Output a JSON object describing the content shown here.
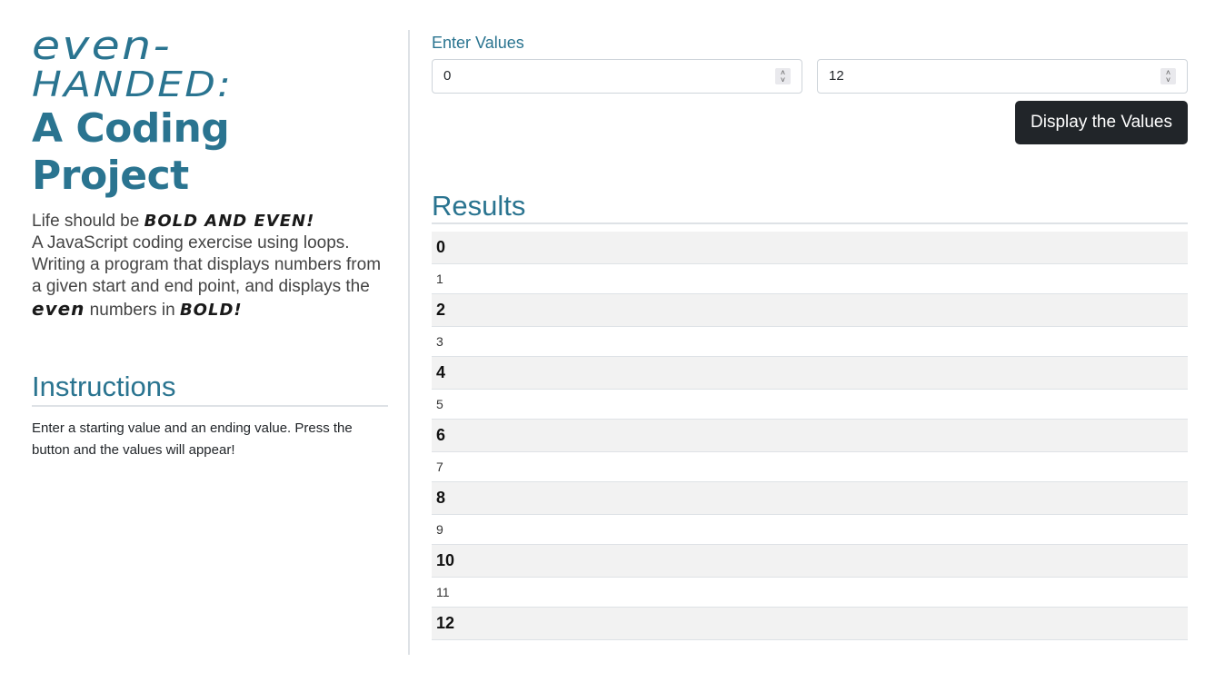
{
  "brand": {
    "stylized_line1": "even-",
    "stylized_line2": "Handed:",
    "title": "A Coding Project"
  },
  "tagline": {
    "part1": "Life should be ",
    "emph1": "Bold and Even!",
    "line2": "A JavaScript coding exercise using loops. Writing a program that displays numbers from a given start and end point, and displays the ",
    "emph2": "even",
    "part3": " numbers in ",
    "emph3": "Bold!"
  },
  "instructions": {
    "title": "Instructions",
    "text": "Enter a starting value and an ending value. Press the button and the values will appear!"
  },
  "form": {
    "label": "Enter Values",
    "start_value": "0",
    "end_value": "12",
    "button_label": "Display the Values"
  },
  "results": {
    "title": "Results",
    "rows": [
      {
        "value": "0",
        "even": true
      },
      {
        "value": "1",
        "even": false
      },
      {
        "value": "2",
        "even": true
      },
      {
        "value": "3",
        "even": false
      },
      {
        "value": "4",
        "even": true
      },
      {
        "value": "5",
        "even": false
      },
      {
        "value": "6",
        "even": true
      },
      {
        "value": "7",
        "even": false
      },
      {
        "value": "8",
        "even": true
      },
      {
        "value": "9",
        "even": false
      },
      {
        "value": "10",
        "even": true
      },
      {
        "value": "11",
        "even": false
      },
      {
        "value": "12",
        "even": true
      }
    ]
  },
  "colors": {
    "accent": "#2a7490",
    "button_bg": "#212529",
    "stripe": "#f2f2f2"
  }
}
